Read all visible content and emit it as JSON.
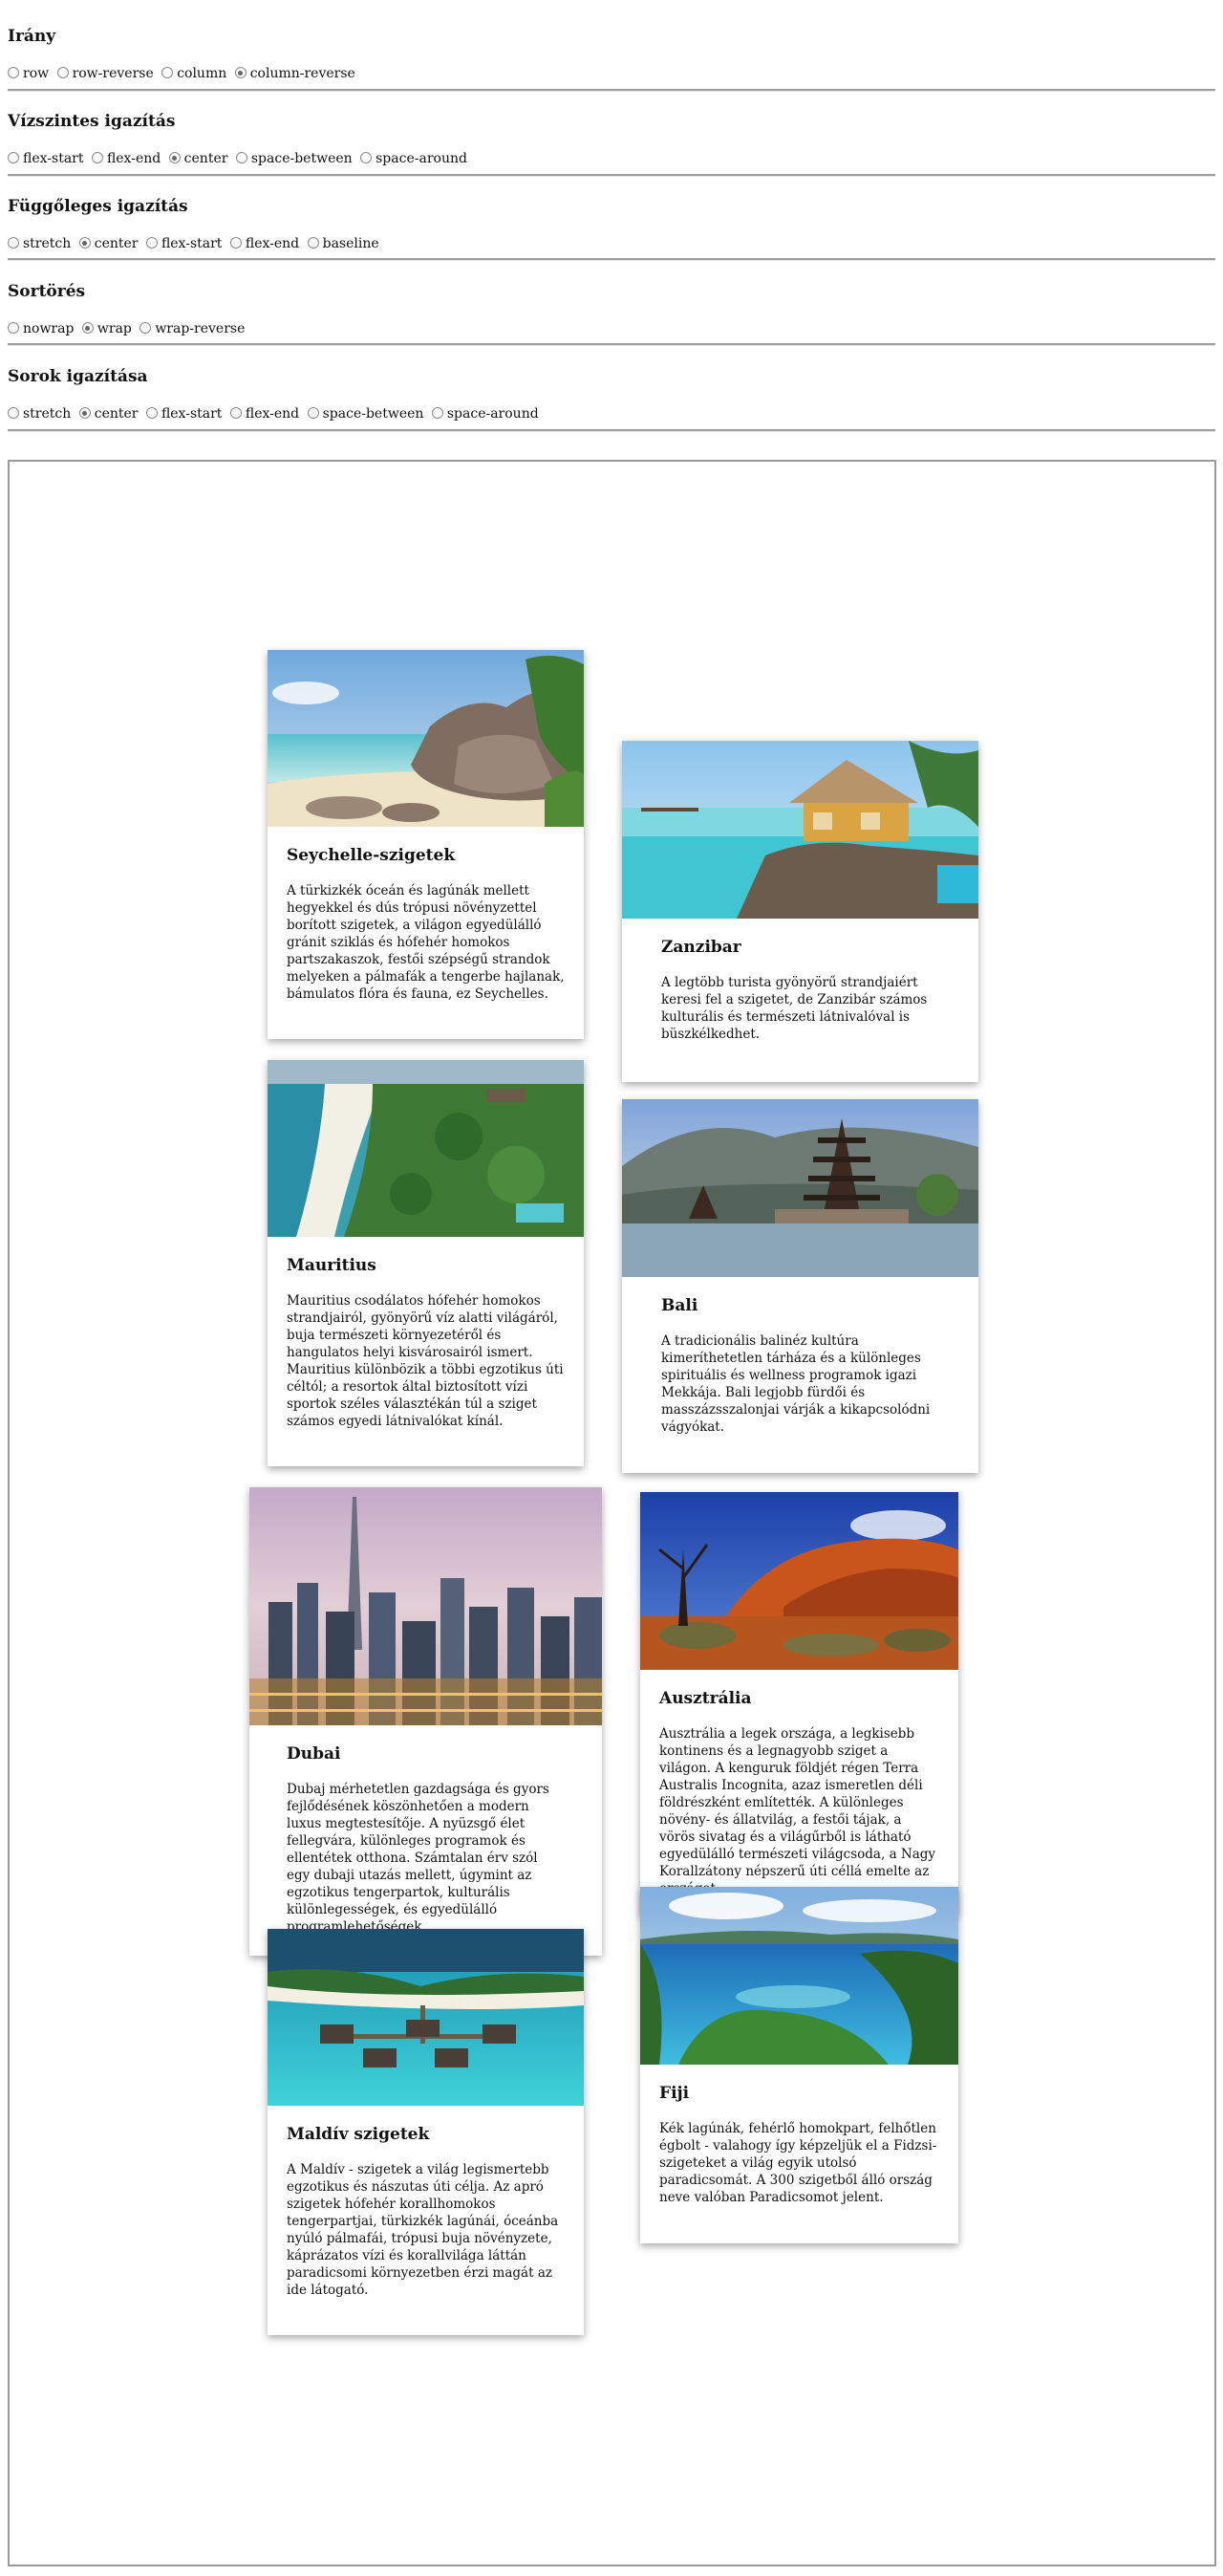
{
  "controls": [
    {
      "key": "direction",
      "title": "Irány",
      "options": [
        "row",
        "row-reverse",
        "column",
        "column-reverse"
      ],
      "selected": "column-reverse"
    },
    {
      "key": "justify",
      "title": "Vízszintes igazítás",
      "options": [
        "flex-start",
        "flex-end",
        "center",
        "space-between",
        "space-around"
      ],
      "selected": "center"
    },
    {
      "key": "align_items",
      "title": "Függőleges igazítás",
      "options": [
        "stretch",
        "center",
        "flex-start",
        "flex-end",
        "baseline"
      ],
      "selected": "center"
    },
    {
      "key": "wrap",
      "title": "Sortörés",
      "options": [
        "nowrap",
        "wrap",
        "wrap-reverse"
      ],
      "selected": "wrap"
    },
    {
      "key": "align_content",
      "title": "Sorok igazítása",
      "options": [
        "stretch",
        "center",
        "flex-start",
        "flex-end",
        "space-between",
        "space-around"
      ],
      "selected": "center"
    }
  ],
  "cards": [
    {
      "title": "Seychelle-szigetek",
      "text": "A türkizkék óceán és lagúnák mellett hegyekkel és dús trópusi növényzettel borított szigetek, a világon egyedülálló gránit sziklás és hófehér homokos partszakaszok, festői szépségű strandok melyeken a pálmafák a tengerbe hajlanak, bámulatos flóra és fauna, ez Seychelles.",
      "image": "beach-granite-rocks"
    },
    {
      "title": "Zanzibar",
      "text": "A legtöbb turista gyönyörű strandjaiért keresi fel a szigetet, de Zanzibár számos kulturális és természeti látnivalóval is büszkélkedhet.",
      "image": "thatched-hut-on-rocks"
    },
    {
      "title": "Mauritius",
      "text": "Mauritius csodálatos hófehér homokos strandjairól, gyönyörű víz alatti világáról, buja természeti környezetéről és hangulatos helyi kisvárosairól ismert. Mauritius különbözik a többi egzotikus úti céltól; a resortok által biztosított vízi sportok széles választékán túl a sziget számos egyedi látnivalókat kínál.",
      "image": "aerial-beach-palms"
    },
    {
      "title": "Bali",
      "text": "A tradicionális balinéz kultúra kimeríthetetlen tárháza és a különleges spirituális és wellness programok igazi Mekkája. Bali legjobb fürdői és masszázsszalonjai várják a kikapcsolódni vágyókat.",
      "image": "temple-on-lake"
    },
    {
      "title": "Dubai",
      "text": "Dubaj mérhetetlen gazdagsága és gyors fejlődésének köszönhetően a modern luxus megtestesítője. A nyüzsgő élet fellegvára, különleges programok és ellentétek otthona. Számtalan érv szól egy dubaji utazás mellett, úgymint az egzotikus tengerpartok, kulturális különlegességek, és egyedülálló programlehetőségek.",
      "image": "skyline-at-dusk"
    },
    {
      "title": "Ausztrália",
      "text": "Ausztrália a legek országa, a legkisebb kontinens és a legnagyobb sziget a világon. A kenguruk földjét régen Terra Australis Incognita, azaz ismeretlen déli földrészként említették. A különleges növény- és állatvilág, a festői tájak, a vörös sivatag és a világűrből is látható egyedülálló természeti világcsoda, a Nagy Korallzátony népszerű úti céllá emelte az országot.",
      "image": "red-rock-outback"
    },
    {
      "title": "Maldív szigetek",
      "text": "A Maldív - szigetek a világ legismertebb egzotikus és nászutas úti célja. Az apró szigetek hófehér korallhomokos tengerpartjai, türkizkék lagúnái, óceánba nyúló pálmafái, trópusi buja növényzete, káprázatos vízi és korallvilága láttán paradicsomi környezetben érzi magát az ide látogató.",
      "image": "overwater-villas"
    },
    {
      "title": "Fiji",
      "text": "Kék lagúnák, fehérlő homokpart, felhőtlen égbolt - valahogy így képzeljük el a Fidzsi-szigeteket a világ egyik utolsó paradicsomát. A 300 szigetből álló ország neve valóban Paradicsomot jelent.",
      "image": "green-island-bay"
    }
  ]
}
